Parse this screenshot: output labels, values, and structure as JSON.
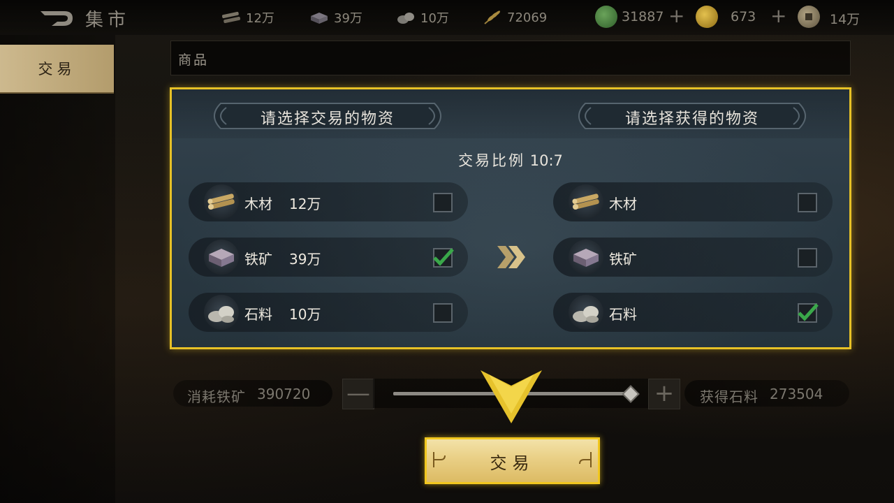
{
  "header": {
    "title": "集市",
    "back_icon": "back-arrow-icon",
    "resources": [
      {
        "name": "wood",
        "icon": "wood-icon",
        "amount": "12万"
      },
      {
        "name": "iron",
        "icon": "iron-ore-icon",
        "amount": "39万"
      },
      {
        "name": "stone",
        "icon": "stone-icon",
        "amount": "10万"
      },
      {
        "name": "grain",
        "icon": "wheat-icon",
        "amount": "72069"
      }
    ],
    "currencies": [
      {
        "name": "jade",
        "icon": "jade-coin-icon",
        "amount": "31887",
        "has_plus": true,
        "color": "#3f7a3a"
      },
      {
        "name": "gold",
        "icon": "gold-coin-icon",
        "amount": "673",
        "has_plus": true,
        "color": "#c9a233"
      },
      {
        "name": "copper",
        "icon": "copper-coin-icon",
        "amount": "14万",
        "has_plus": false,
        "color": "#8a7a5c"
      }
    ]
  },
  "sidebar": {
    "tabs": [
      {
        "label": "交易",
        "selected": true
      }
    ]
  },
  "category": {
    "label": "商品"
  },
  "trade": {
    "give_header": "请选择交易的物资",
    "get_header": "请选择获得的物资",
    "ratio_label": "交易比例",
    "ratio_value": "10:7",
    "give_items": [
      {
        "name": "木材",
        "amount": "12万",
        "icon": "wood-icon",
        "checked": false
      },
      {
        "name": "铁矿",
        "amount": "39万",
        "icon": "iron-ore-icon",
        "checked": true
      },
      {
        "name": "石料",
        "amount": "10万",
        "icon": "stone-icon",
        "checked": false
      }
    ],
    "get_items": [
      {
        "name": "木材",
        "icon": "wood-icon",
        "checked": false
      },
      {
        "name": "铁矿",
        "icon": "iron-ore-icon",
        "checked": false
      },
      {
        "name": "石料",
        "icon": "stone-icon",
        "checked": true
      }
    ]
  },
  "quantity": {
    "consume_label": "消耗铁矿",
    "consume_value": "390720",
    "gain_label": "获得石料",
    "gain_value": "273504",
    "slider_fraction": 1.0,
    "minus_label": "—",
    "plus_label": "+"
  },
  "action": {
    "trade_button": "交易"
  },
  "colors": {
    "highlight": "#e7c126",
    "button_gold": "#e9cf85",
    "check_green": "#3aa84a"
  }
}
